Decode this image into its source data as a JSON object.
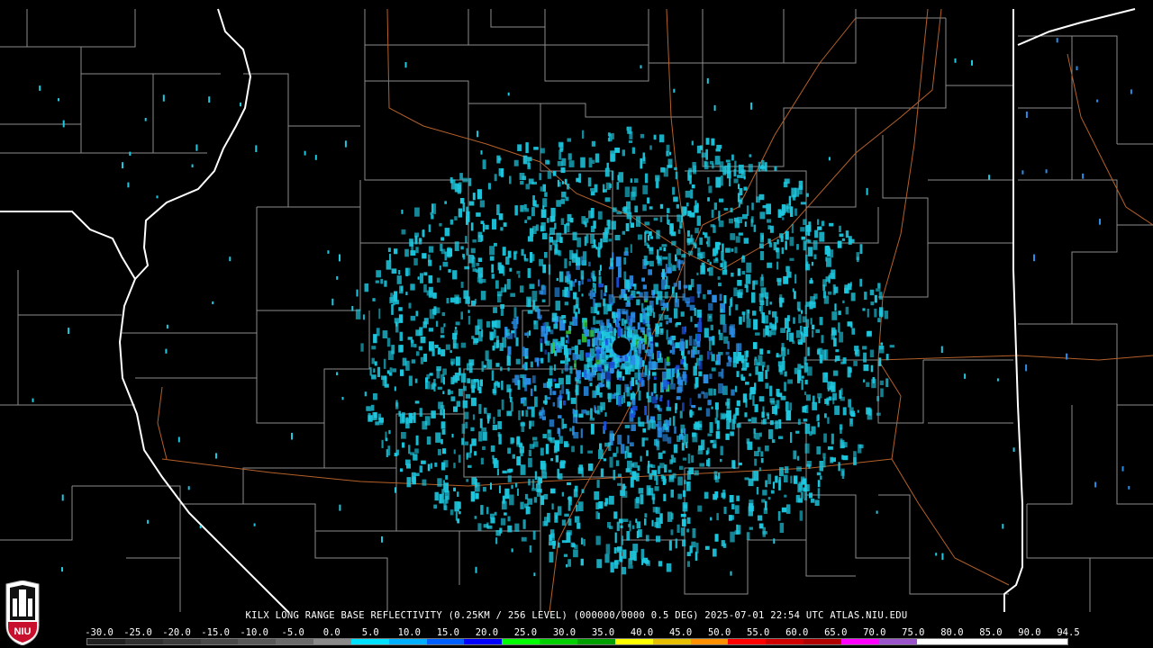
{
  "caption": "KILX LONG RANGE BASE REFLECTIVITY (0.25KM / 256 LEVEL) (000000/0000 0.5 DEG) 2025-07-01 22:54 UTC  ATLAS.NIU.EDU",
  "scale_labels": [
    "-30.0",
    "-25.0",
    "-20.0",
    "-15.0",
    "-10.0",
    "-5.0",
    "0.0",
    "5.0",
    "10.0",
    "15.0",
    "20.0",
    "25.0",
    "30.0",
    "35.0",
    "40.0",
    "45.0",
    "50.0",
    "55.0",
    "60.0",
    "65.0",
    "70.0",
    "75.0",
    "80.0",
    "85.0",
    "90.0",
    "94.5"
  ],
  "colorbar_colors": [
    "#202020",
    "#303030",
    "#3c3c3c",
    "#4a4a4a",
    "#585858",
    "#6a6a6a",
    "#8a8a8a",
    "#00e0ff",
    "#00b0ff",
    "#0060ff",
    "#0000ff",
    "#00ff00",
    "#00d000",
    "#00a000",
    "#ffff00",
    "#e6c000",
    "#ff9000",
    "#ff0000",
    "#d00000",
    "#b00000",
    "#ff00ff",
    "#9955c9",
    "#ffffff",
    "#ffffff",
    "#ffffff",
    "#ffffff"
  ],
  "logo_text": "NIU",
  "colors": {
    "state_border": "#ffffff",
    "county_border": "#8c8c8c",
    "highway": "#b5602a",
    "radar_light": "#1ec8e0",
    "radar_mid": "#2a8ee8",
    "radar_strong": "#1a50e0",
    "radar_green": "#33cc33"
  }
}
